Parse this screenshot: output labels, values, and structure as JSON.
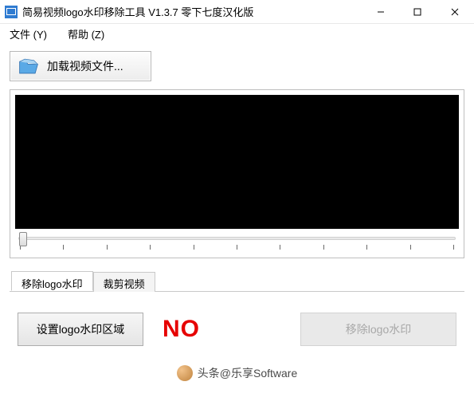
{
  "titlebar": {
    "title": "简易视频logo水印移除工具 V1.3.7 零下七度汉化版"
  },
  "menu": {
    "file": "文件 (Y)",
    "help": "帮助 (Z)"
  },
  "toolbar": {
    "load_label": "加载视频文件..."
  },
  "tabs": {
    "remove": "移除logo水印",
    "crop": "裁剪视频"
  },
  "panel": {
    "set_region": "设置logo水印区域",
    "status": "NO",
    "remove_btn": "移除logo水印"
  },
  "footer": {
    "source": "头条@乐享Software"
  }
}
